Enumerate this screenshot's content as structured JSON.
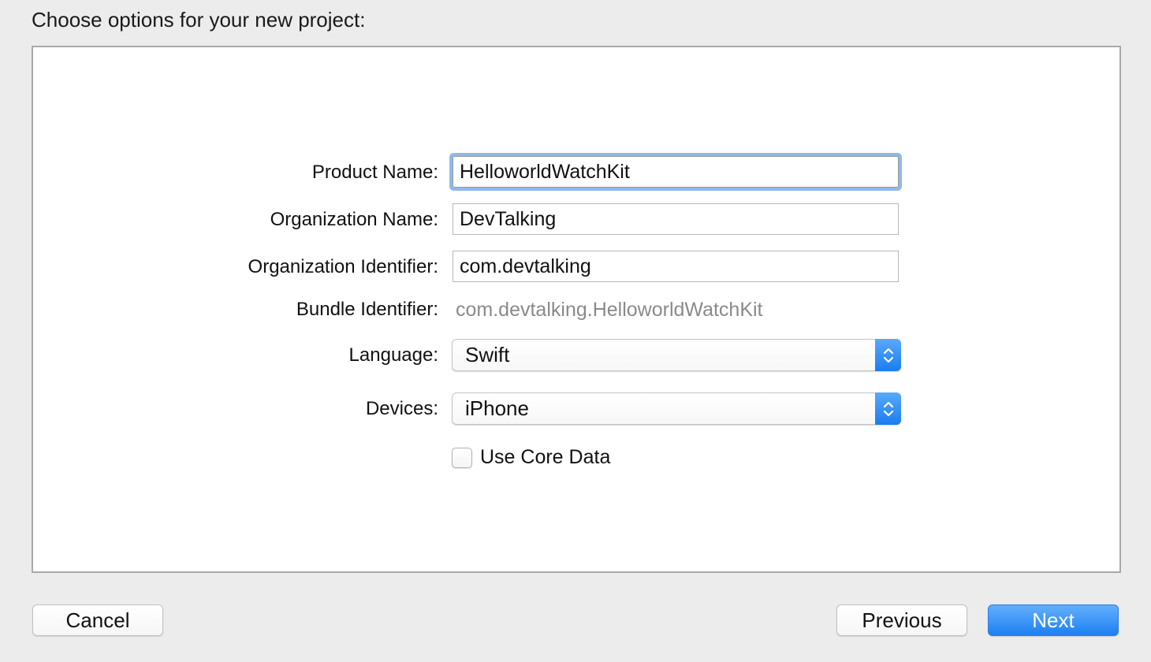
{
  "header": {
    "title": "Choose options for your new project:"
  },
  "form": {
    "product_name": {
      "label": "Product Name:",
      "value": "HelloworldWatchKit"
    },
    "organization_name": {
      "label": "Organization Name:",
      "value": "DevTalking"
    },
    "organization_identifier": {
      "label": "Organization Identifier:",
      "value": "com.devtalking"
    },
    "bundle_identifier": {
      "label": "Bundle Identifier:",
      "value": "com.devtalking.HelloworldWatchKit"
    },
    "language": {
      "label": "Language:",
      "value": "Swift",
      "icon": "updown-arrows-icon"
    },
    "devices": {
      "label": "Devices:",
      "value": "iPhone",
      "icon": "updown-arrows-icon"
    },
    "use_core_data": {
      "label": "Use Core Data",
      "checked": false
    }
  },
  "footer": {
    "cancel_label": "Cancel",
    "previous_label": "Previous",
    "next_label": "Next"
  },
  "colors": {
    "accent": "#1d7ff1",
    "focus_ring": "#8fb9ec",
    "background": "#ececec"
  }
}
